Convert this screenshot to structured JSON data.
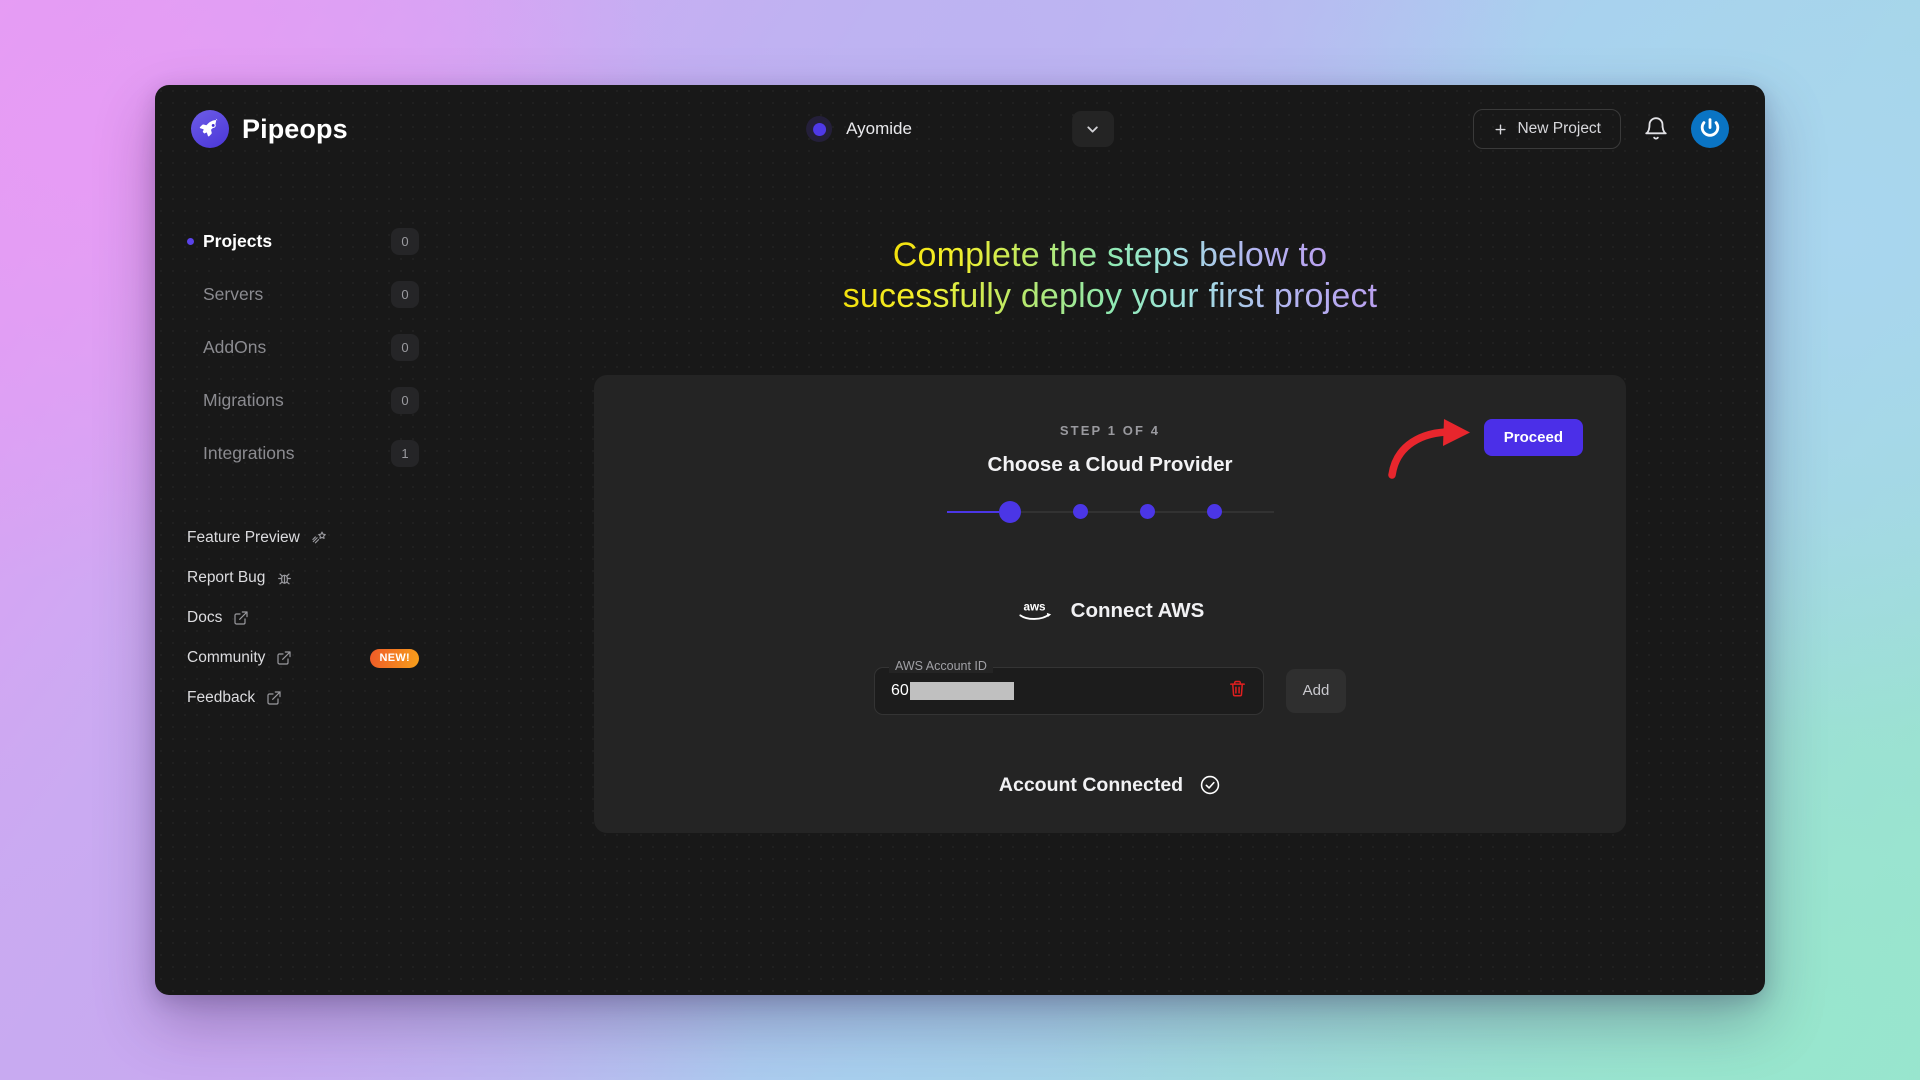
{
  "brand": {
    "name": "Pipeops",
    "logo_icon": "rocket-icon"
  },
  "topbar": {
    "workspace": {
      "name": "Ayomide",
      "dot_color": "#4f39e8",
      "caret_icon": "chevron-down-icon"
    },
    "new_project_label": "New Project",
    "plus_icon": "plus-icon",
    "bell_icon": "bell-icon",
    "avatar_icon": "user-avatar-icon"
  },
  "sidebar": {
    "nav": [
      {
        "label": "Projects",
        "badge": "0",
        "active": true
      },
      {
        "label": "Servers",
        "badge": "0",
        "active": false
      },
      {
        "label": "AddOns",
        "badge": "0",
        "active": false
      },
      {
        "label": "Migrations",
        "badge": "0",
        "active": false
      },
      {
        "label": "Integrations",
        "badge": "1",
        "active": false
      }
    ],
    "links": [
      {
        "label": "Feature Preview",
        "icon": "shooting-star-icon",
        "badge": ""
      },
      {
        "label": "Report Bug",
        "icon": "bug-icon",
        "badge": ""
      },
      {
        "label": "Docs",
        "icon": "external-link-icon",
        "badge": ""
      },
      {
        "label": "Community",
        "icon": "external-link-icon",
        "badge": "NEW!"
      },
      {
        "label": "Feedback",
        "icon": "external-link-icon",
        "badge": ""
      }
    ]
  },
  "main": {
    "headline_line1": "Complete the steps below to",
    "headline_line2": "sucessfully deploy your first project",
    "card": {
      "eyebrow": "STEP 1 OF 4",
      "title": "Choose a Cloud Provider",
      "proceed_label": "Proceed",
      "steps_total": 4,
      "steps_current": 1,
      "provider_title": "Connect AWS",
      "provider_logo": "aws-logo-icon",
      "field": {
        "label": "AWS Account ID",
        "value": "60",
        "redacted": true,
        "delete_icon": "trash-icon"
      },
      "add_label": "Add",
      "connected_label": "Account Connected",
      "connected_icon": "check-circle-icon"
    }
  },
  "annotation": {
    "arrow_color": "#e8262d",
    "arrow_icon": "curved-arrow-icon"
  },
  "colors": {
    "accent": "#4b2fe8",
    "badge_new": "#f05a28",
    "card_bg": "#242424",
    "app_bg": "#181818"
  }
}
